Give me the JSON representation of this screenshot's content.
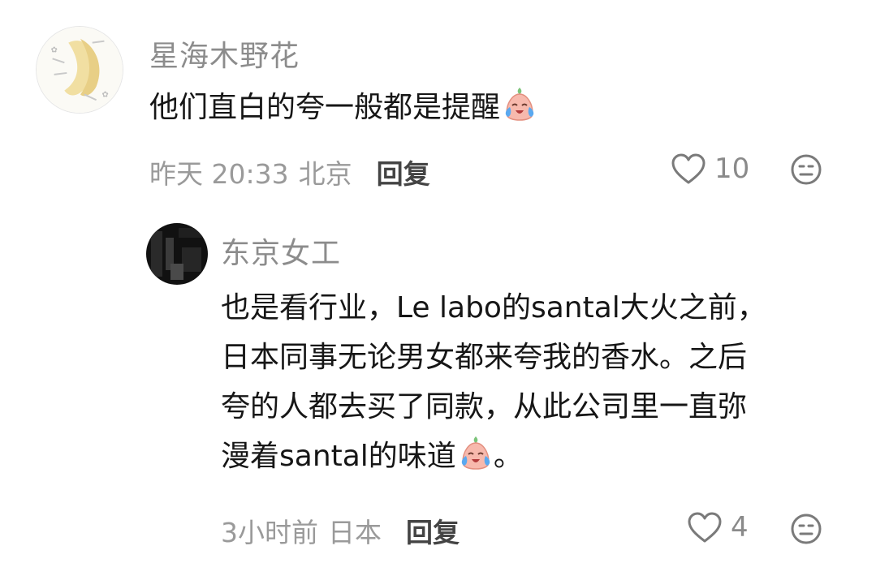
{
  "comments": [
    {
      "username": "星海木野花",
      "content_lines": [
        "他们直白的夸一般都是提醒"
      ],
      "emoji": "crying-face-emoji",
      "time": "昨天 20:33",
      "location": "北京",
      "reply_label": "回复",
      "like_count": "10"
    }
  ],
  "replies": [
    {
      "username": "东京女工",
      "content_lines": [
        "也是看行业，Le labo的santal大火之前，",
        "日本同事无论男女都来夸我的香水。之后",
        "夸的人都去买了同款，从此公司里一直弥",
        "漫着santal的味道"
      ],
      "emoji": "crying-face-emoji",
      "content_tail": "。",
      "time": "3小时前",
      "location": "日本",
      "reply_label": "回复",
      "like_count": "4"
    }
  ],
  "icons": {
    "like": "heart-outline-icon",
    "dislike": "neutral-face-icon"
  },
  "colors": {
    "username": "#8c8c8c",
    "meta": "#9a9a9a",
    "reply": "#444444",
    "emoji_face": "#f7b9ad"
  }
}
